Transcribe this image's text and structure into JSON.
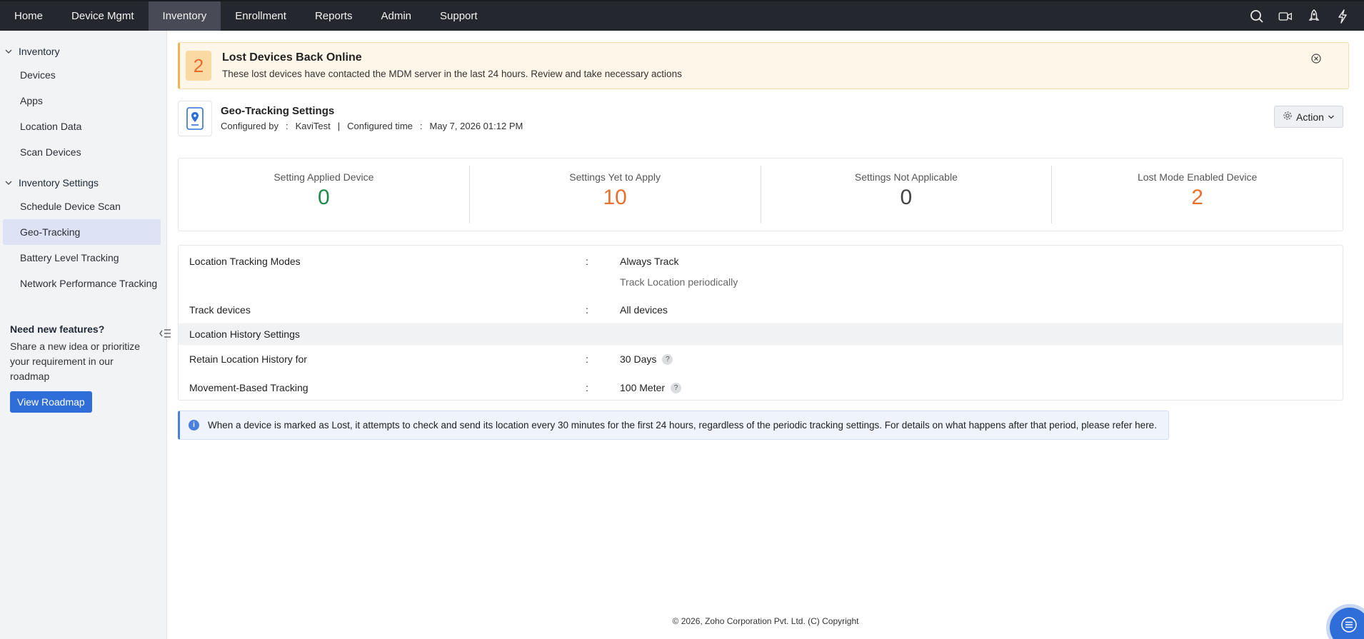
{
  "nav": {
    "items": [
      "Home",
      "Device Mgmt",
      "Inventory",
      "Enrollment",
      "Reports",
      "Admin",
      "Support"
    ],
    "active": "Inventory",
    "right_icons": [
      "search-icon",
      "video-icon",
      "rocket-icon",
      "bolt-icon"
    ]
  },
  "sidebar": {
    "group1": "Inventory",
    "group1_items": [
      "Devices",
      "Apps",
      "Location Data",
      "Scan Devices"
    ],
    "group2": "Inventory Settings",
    "group2_items": [
      "Schedule Device Scan",
      "Geo-Tracking",
      "Battery Level Tracking",
      "Network Performance Tracking"
    ],
    "active": "Geo-Tracking",
    "promo_title": "Need new features?",
    "promo_text": "Share a new idea or prioritize your requirement in our roadmap",
    "promo_button": "View Roadmap"
  },
  "alert": {
    "count": "2",
    "title": "Lost Devices Back Online",
    "description": "These lost devices have contacted the MDM server in the last 24 hours. Review and take necessary actions"
  },
  "settings": {
    "title": "Geo-Tracking Settings",
    "configured_by_label": "Configured by",
    "configured_by": "KaviTest",
    "configured_time_label": "Configured time",
    "configured_time": "May 7, 2026 01:12 PM",
    "action_label": "Action"
  },
  "stats": [
    {
      "label": "Setting Applied Device",
      "value": "0",
      "color": "#1e8a4c"
    },
    {
      "label": "Settings Yet to Apply",
      "value": "10",
      "color": "#e8702e"
    },
    {
      "label": "Settings Not Applicable",
      "value": "0",
      "color": "#444444"
    },
    {
      "label": "Lost Mode Enabled Device",
      "value": "2",
      "color": "#e8702e"
    }
  ],
  "details": {
    "tracking_modes_label": "Location Tracking Modes",
    "tracking_modes_value": "Always Track",
    "tracking_modes_sub": "Track Location periodically",
    "track_devices_label": "Track devices",
    "track_devices_value": "All devices",
    "history_section": "Location History Settings",
    "retain_label": "Retain Location History for",
    "retain_value": "30 Days",
    "movement_label": "Movement-Based Tracking",
    "movement_value": "100 Meter",
    "separator": ":"
  },
  "info": {
    "text": "When a device is marked as Lost, it attempts to check and send its location every 30 minutes for the first 24 hours, regardless of the periodic tracking settings. For details on what happens after that period, please refer here."
  },
  "footer": "© 2026, Zoho Corporation Pvt. Ltd. (C) Copyright"
}
